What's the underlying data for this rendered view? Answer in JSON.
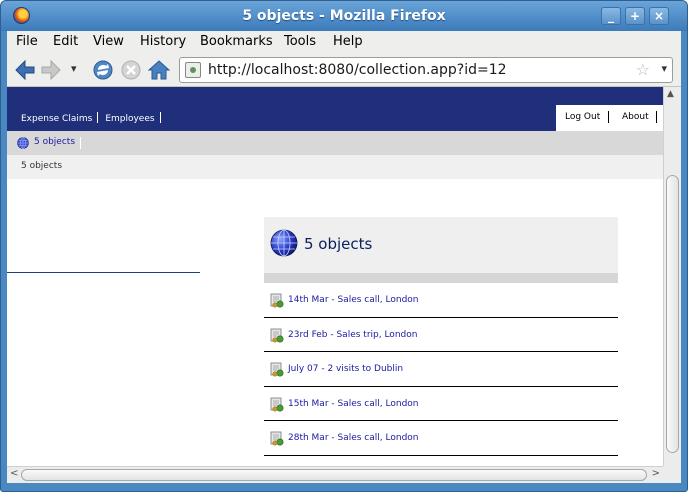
{
  "window": {
    "title": "5 objects - Mozilla Firefox",
    "controls": {
      "minimize": "_",
      "maximize": "+",
      "close": "×"
    }
  },
  "menubar": {
    "items": [
      "File",
      "Edit",
      "View",
      "History",
      "Bookmarks",
      "Tools",
      "Help"
    ]
  },
  "navbar": {
    "url": "http://localhost:8080/collection.app?id=12",
    "star": "☆",
    "dropdown": "▾",
    "history_dropdown": "▾"
  },
  "app": {
    "nav_left": [
      "Expense Claims",
      "Employees"
    ],
    "nav_right": [
      "Log Out",
      "About"
    ],
    "breadcrumb": "5 objects",
    "subtitle": "5 objects",
    "panel_title": "5 objects",
    "items": [
      "14th Mar - Sales call, London",
      "23rd Feb - Sales trip, London",
      "July 07 - 2 visits to Dublin",
      "15th Mar - Sales call, London",
      "28th Mar - Sales call, London"
    ]
  },
  "colors": {
    "app_nav_bg": "#1f2f7a",
    "link": "#1a1aa0",
    "titlebar": "#4a88c2"
  }
}
